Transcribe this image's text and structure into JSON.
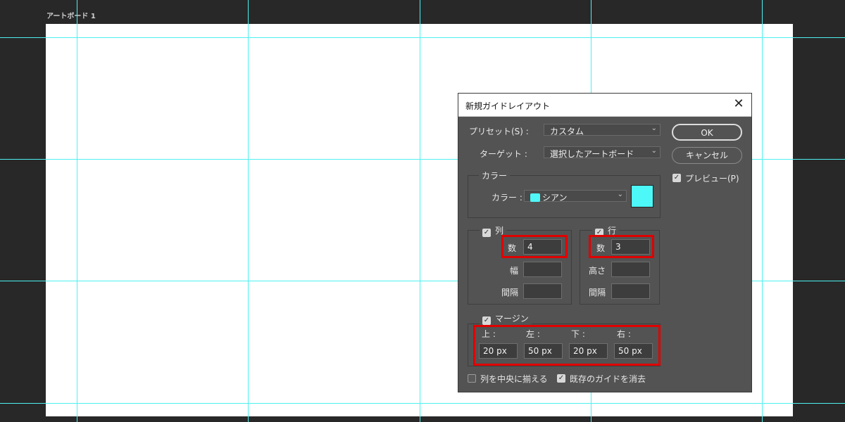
{
  "artboard": {
    "label": "アートボード 1"
  },
  "colors": {
    "guide": "#4ef0f0",
    "canvas_bg": "#282828",
    "dialog_bg": "#535353",
    "highlight": "#e00000",
    "swatch": "#4cf8f8"
  },
  "dialog": {
    "title": "新規ガイドレイアウト",
    "close_icon": "close-icon",
    "preset": {
      "label": "プリセット(S) :",
      "value": "カスタム"
    },
    "target": {
      "label": "ターゲット :",
      "value": "選択したアートボード"
    },
    "color_group": {
      "legend": "カラー",
      "label": "カラー :",
      "value": "シアン"
    },
    "columns": {
      "legend": "列",
      "checked": true,
      "count_label": "数",
      "count": "4",
      "width_label": "幅",
      "width": "",
      "gutter_label": "間隔",
      "gutter": ""
    },
    "rows": {
      "legend": "行",
      "checked": true,
      "count_label": "数",
      "count": "3",
      "height_label": "高さ",
      "height": "",
      "gutter_label": "間隔",
      "gutter": ""
    },
    "margin": {
      "legend": "マージン",
      "checked": true,
      "top_label": "上 :",
      "top": "20 px",
      "left_label": "左 :",
      "left": "50 px",
      "bottom_label": "下 :",
      "bottom": "20 px",
      "right_label": "右 :",
      "right": "50 px"
    },
    "center_columns": {
      "label": "列を中央に揃える",
      "checked": false
    },
    "clear_existing": {
      "label": "既存のガイドを消去",
      "checked": true
    },
    "ok_label": "OK",
    "cancel_label": "キャンセル",
    "preview": {
      "label": "プレビュー(P)",
      "checked": true
    }
  }
}
